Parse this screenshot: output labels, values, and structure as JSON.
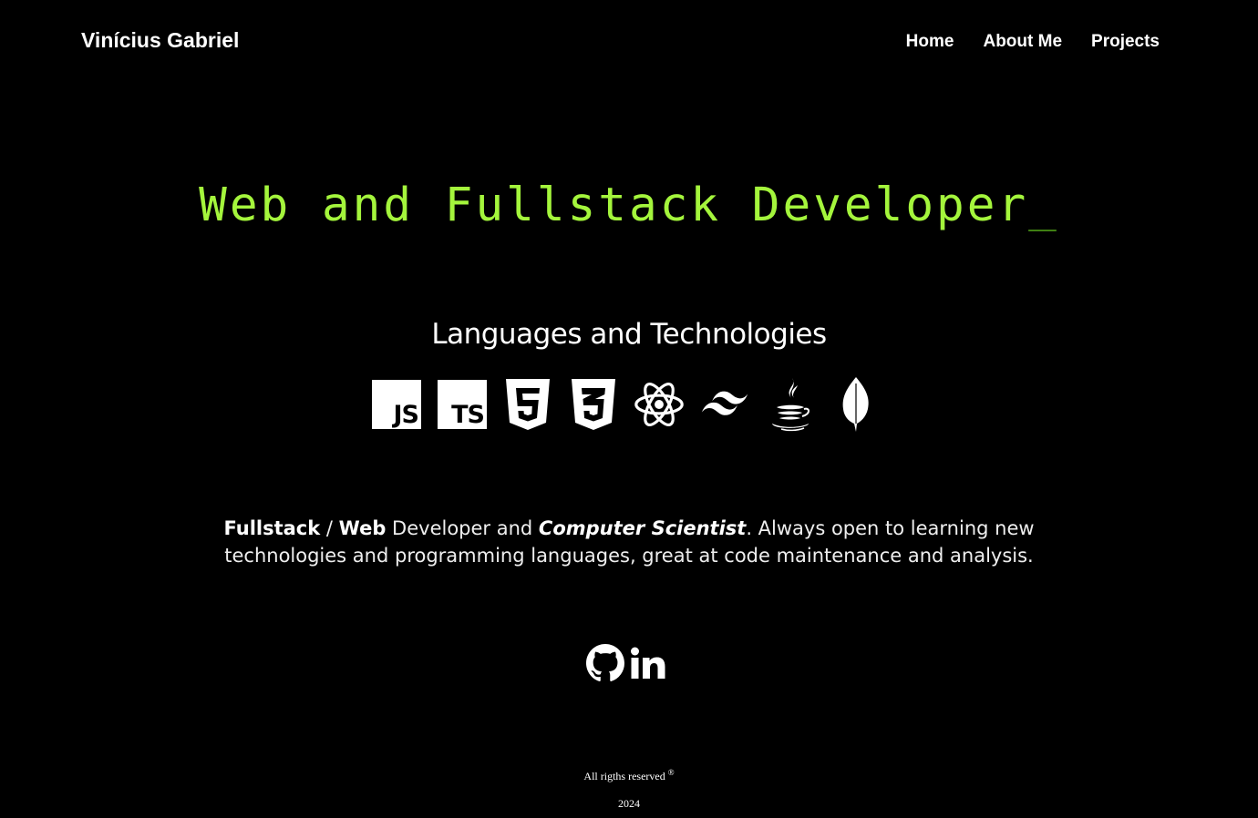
{
  "header": {
    "brand": "Vinícius Gabriel",
    "nav": [
      "Home",
      "About Me",
      "Projects"
    ]
  },
  "hero": {
    "headline": "Web and Fullstack Developer",
    "cursor": "_",
    "headline_color": "#a4f53c"
  },
  "technologies": {
    "title": "Languages and Technologies",
    "icons": [
      "javascript-icon",
      "typescript-icon",
      "html5-icon",
      "css3-icon",
      "react-icon",
      "tailwind-icon",
      "java-icon",
      "mongodb-icon"
    ],
    "js_label": "JS",
    "ts_label": "TS"
  },
  "description": {
    "part1": "Fullstack",
    "part2": " / ",
    "part3": "Web",
    "part4": " Developer and ",
    "part5": "Computer Scientist",
    "part6": ". Always open to learning new technologies and programming languages, great at code maintenance and analysis."
  },
  "social": {
    "icons": [
      "github-icon",
      "linkedin-icon"
    ]
  },
  "footer": {
    "rights": "All rigths reserved",
    "registered": "®",
    "year": "2024"
  }
}
